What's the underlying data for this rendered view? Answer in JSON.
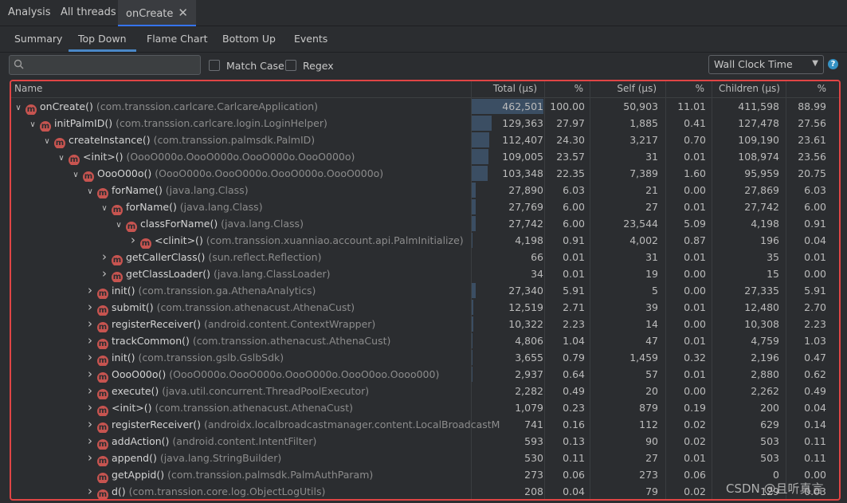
{
  "top_tabs": [
    "Analysis",
    "All threads",
    "onCreate"
  ],
  "sub_tabs": [
    "Summary",
    "Top Down",
    "Flame Chart",
    "Bottom Up",
    "Events"
  ],
  "search": {
    "placeholder": "",
    "value": ""
  },
  "options": {
    "match_case": "Match Case",
    "regex": "Regex"
  },
  "clock_select": {
    "value": "Wall Clock Time"
  },
  "help": "?",
  "columns": [
    "Name",
    "Total (μs)",
    "%",
    "Self (μs)",
    "%",
    "Children (μs)",
    "%"
  ],
  "rows": [
    {
      "depth": 0,
      "arrow": "down",
      "name": "onCreate()",
      "cls": "(com.transsion.carlcare.CarlcareApplication)",
      "total": "462,501",
      "total_pct": "100.00",
      "self": "50,903",
      "self_pct": "11.01",
      "children": "411,598",
      "children_pct": "88.99",
      "share": 1.0
    },
    {
      "depth": 1,
      "arrow": "down",
      "name": "initPalmID()",
      "cls": "(com.transsion.carlcare.login.LoginHelper)",
      "total": "129,363",
      "total_pct": "27.97",
      "self": "1,885",
      "self_pct": "0.41",
      "children": "127,478",
      "children_pct": "27.56",
      "share": 0.2797
    },
    {
      "depth": 2,
      "arrow": "down",
      "name": "createInstance()",
      "cls": "(com.transsion.palmsdk.PalmID)",
      "total": "112,407",
      "total_pct": "24.30",
      "self": "3,217",
      "self_pct": "0.70",
      "children": "109,190",
      "children_pct": "23.61",
      "share": 0.243
    },
    {
      "depth": 3,
      "arrow": "down",
      "name": "<init>()",
      "cls": "(OooO000o.OooO000o.OooO000o.OooO000o)",
      "total": "109,005",
      "total_pct": "23.57",
      "self": "31",
      "self_pct": "0.01",
      "children": "108,974",
      "children_pct": "23.56",
      "share": 0.2357
    },
    {
      "depth": 4,
      "arrow": "down",
      "name": "OooO00o()",
      "cls": "(OooO000o.OooO000o.OooO000o.OooO000o)",
      "total": "103,348",
      "total_pct": "22.35",
      "self": "7,389",
      "self_pct": "1.60",
      "children": "95,959",
      "children_pct": "20.75",
      "share": 0.2235
    },
    {
      "depth": 5,
      "arrow": "down",
      "name": "forName()",
      "cls": "(java.lang.Class)",
      "total": "27,890",
      "total_pct": "6.03",
      "self": "21",
      "self_pct": "0.00",
      "children": "27,869",
      "children_pct": "6.03",
      "share": 0.0603
    },
    {
      "depth": 6,
      "arrow": "down",
      "name": "forName()",
      "cls": "(java.lang.Class)",
      "total": "27,769",
      "total_pct": "6.00",
      "self": "27",
      "self_pct": "0.01",
      "children": "27,742",
      "children_pct": "6.00",
      "share": 0.06
    },
    {
      "depth": 7,
      "arrow": "down",
      "name": "classForName()",
      "cls": "(java.lang.Class)",
      "total": "27,742",
      "total_pct": "6.00",
      "self": "23,544",
      "self_pct": "5.09",
      "children": "4,198",
      "children_pct": "0.91",
      "share": 0.06
    },
    {
      "depth": 8,
      "arrow": "right",
      "name": "<clinit>()",
      "cls": "(com.transsion.xuanniao.account.api.PalmInitialize)",
      "total": "4,198",
      "total_pct": "0.91",
      "self": "4,002",
      "self_pct": "0.87",
      "children": "196",
      "children_pct": "0.04",
      "share": 0.0091
    },
    {
      "depth": 6,
      "arrow": "right",
      "name": "getCallerClass()",
      "cls": "(sun.reflect.Reflection)",
      "total": "66",
      "total_pct": "0.01",
      "self": "31",
      "self_pct": "0.01",
      "children": "35",
      "children_pct": "0.01",
      "share": 0.0001
    },
    {
      "depth": 6,
      "arrow": "right",
      "name": "getClassLoader()",
      "cls": "(java.lang.ClassLoader)",
      "total": "34",
      "total_pct": "0.01",
      "self": "19",
      "self_pct": "0.00",
      "children": "15",
      "children_pct": "0.00",
      "share": 0.0001
    },
    {
      "depth": 5,
      "arrow": "right",
      "name": "init()",
      "cls": "(com.transsion.ga.AthenaAnalytics)",
      "total": "27,340",
      "total_pct": "5.91",
      "self": "5",
      "self_pct": "0.00",
      "children": "27,335",
      "children_pct": "5.91",
      "share": 0.0591
    },
    {
      "depth": 5,
      "arrow": "right",
      "name": "submit()",
      "cls": "(com.transsion.athenacust.AthenaCust)",
      "total": "12,519",
      "total_pct": "2.71",
      "self": "39",
      "self_pct": "0.01",
      "children": "12,480",
      "children_pct": "2.70",
      "share": 0.0271
    },
    {
      "depth": 5,
      "arrow": "right",
      "name": "registerReceiver()",
      "cls": "(android.content.ContextWrapper)",
      "total": "10,322",
      "total_pct": "2.23",
      "self": "14",
      "self_pct": "0.00",
      "children": "10,308",
      "children_pct": "2.23",
      "share": 0.0223
    },
    {
      "depth": 5,
      "arrow": "right",
      "name": "trackCommon()",
      "cls": "(com.transsion.athenacust.AthenaCust)",
      "total": "4,806",
      "total_pct": "1.04",
      "self": "47",
      "self_pct": "0.01",
      "children": "4,759",
      "children_pct": "1.03",
      "share": 0.0104
    },
    {
      "depth": 5,
      "arrow": "right",
      "name": "init()",
      "cls": "(com.transsion.gslb.GslbSdk)",
      "total": "3,655",
      "total_pct": "0.79",
      "self": "1,459",
      "self_pct": "0.32",
      "children": "2,196",
      "children_pct": "0.47",
      "share": 0.0079
    },
    {
      "depth": 5,
      "arrow": "right",
      "name": "OooO00o()",
      "cls": "(OooO000o.OooO000o.OooO000o.OooO0oo.Oooo000)",
      "total": "2,937",
      "total_pct": "0.64",
      "self": "57",
      "self_pct": "0.01",
      "children": "2,880",
      "children_pct": "0.62",
      "share": 0.0064
    },
    {
      "depth": 5,
      "arrow": "right",
      "name": "execute()",
      "cls": "(java.util.concurrent.ThreadPoolExecutor)",
      "total": "2,282",
      "total_pct": "0.49",
      "self": "20",
      "self_pct": "0.00",
      "children": "2,262",
      "children_pct": "0.49",
      "share": 0.0049
    },
    {
      "depth": 5,
      "arrow": "right",
      "name": "<init>()",
      "cls": "(com.transsion.athenacust.AthenaCust)",
      "total": "1,079",
      "total_pct": "0.23",
      "self": "879",
      "self_pct": "0.19",
      "children": "200",
      "children_pct": "0.04",
      "share": 0.0023
    },
    {
      "depth": 5,
      "arrow": "right",
      "name": "registerReceiver()",
      "cls": "(androidx.localbroadcastmanager.content.LocalBroadcastM",
      "total": "741",
      "total_pct": "0.16",
      "self": "112",
      "self_pct": "0.02",
      "children": "629",
      "children_pct": "0.14",
      "share": 0.0016
    },
    {
      "depth": 5,
      "arrow": "right",
      "name": "addAction()",
      "cls": "(android.content.IntentFilter)",
      "total": "593",
      "total_pct": "0.13",
      "self": "90",
      "self_pct": "0.02",
      "children": "503",
      "children_pct": "0.11",
      "share": 0.0013
    },
    {
      "depth": 5,
      "arrow": "right",
      "name": "append()",
      "cls": "(java.lang.StringBuilder)",
      "total": "530",
      "total_pct": "0.11",
      "self": "27",
      "self_pct": "0.01",
      "children": "503",
      "children_pct": "0.11",
      "share": 0.0011
    },
    {
      "depth": 5,
      "arrow": "none",
      "name": "getAppid()",
      "cls": "(com.transsion.palmsdk.PalmAuthParam)",
      "total": "273",
      "total_pct": "0.06",
      "self": "273",
      "self_pct": "0.06",
      "children": "0",
      "children_pct": "0.00",
      "share": 0.0006
    },
    {
      "depth": 5,
      "arrow": "right",
      "name": "d()",
      "cls": "(com.transsion.core.log.ObjectLogUtils)",
      "total": "208",
      "total_pct": "0.04",
      "self": "79",
      "self_pct": "0.02",
      "children": "129",
      "children_pct": "0.03",
      "share": 0.0004
    }
  ],
  "method_badge": "m",
  "watermark": "CSDN @且听真言",
  "colors": {
    "accent": "#3574f0",
    "highlight_border": "#e04545",
    "method_icon": "#c75450",
    "bar": "#3b4e63"
  }
}
